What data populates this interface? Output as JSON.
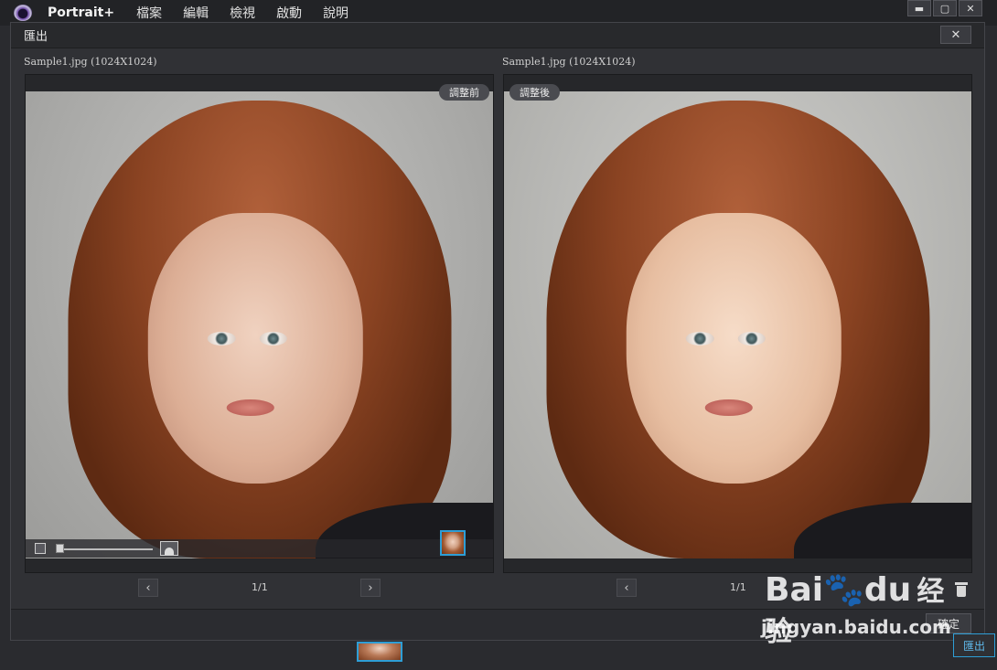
{
  "app": {
    "brand": "Portrait+",
    "menu": [
      "檔案",
      "編輯",
      "檢視",
      "啟動",
      "說明"
    ],
    "window_controls": {
      "minimize": "▬",
      "maximize": "▢",
      "close": "✕"
    }
  },
  "dialog": {
    "title": "匯出",
    "close_glyph": "✕",
    "left": {
      "file_label": "Sample1.jpg (1024X1024)",
      "tag": "調整前"
    },
    "right": {
      "file_label": "Sample1.jpg (1024X1024)",
      "tag": "調整後"
    },
    "pager_left": {
      "prev": "‹",
      "page": "1/1",
      "next": "›"
    },
    "pager_right": {
      "prev": "‹",
      "page": "1/1"
    },
    "confirm_label": "確定"
  },
  "background": {
    "export_label": "匯出"
  },
  "watermark": {
    "logo_text": "Bai",
    "logo_suffix": "du",
    "logo_cn": "经验",
    "url": "jingyan.baidu.com"
  }
}
